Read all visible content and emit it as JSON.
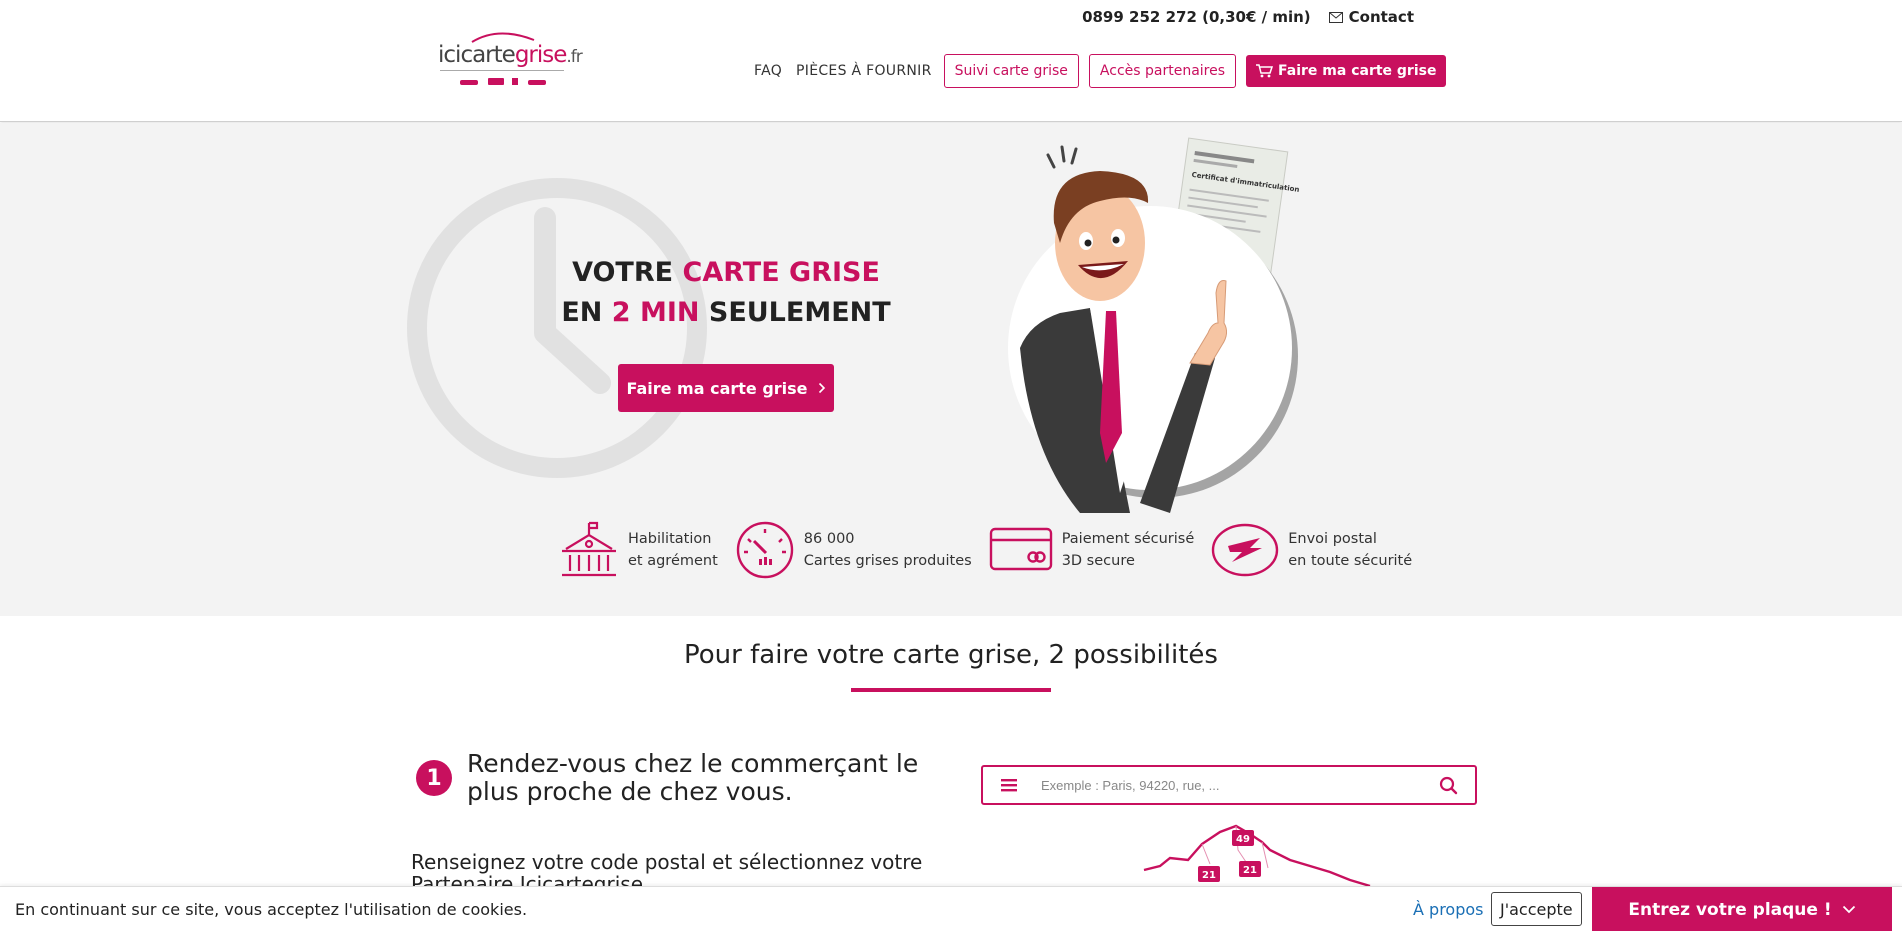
{
  "header": {
    "logo": {
      "part1": "ici",
      "part2": "carte",
      "part3": "grise",
      "part4": ".fr"
    },
    "phone": "0899 252 272 (0,30€ / min)",
    "contact": "Contact",
    "nav": {
      "faq": "FAQ",
      "pieces": "PIÈCES À FOURNIR",
      "suivi": "Suivi carte grise",
      "acces": "Accès partenaires",
      "faire": "Faire ma carte grise"
    }
  },
  "hero": {
    "line1_a": "VOTRE ",
    "line1_b": "CARTE GRISE",
    "line2_a": "EN ",
    "line2_b": "2 MIN",
    "line2_c": " SEULEMENT",
    "button": "Faire ma carte grise",
    "document_title": "Certificat d'immatriculation",
    "features": [
      {
        "l1": "Habilitation",
        "l2": "et agrément"
      },
      {
        "l1": "86 000",
        "l2": "Cartes grises produites"
      },
      {
        "l1": "Paiement sécurisé",
        "l2": "3D secure"
      },
      {
        "l1": "Envoi postal",
        "l2": "en toute sécurité"
      }
    ]
  },
  "section": {
    "title": "Pour faire votre carte grise, 2 possibilités",
    "step1": {
      "number": "1",
      "title": "Rendez-vous chez le commerçant le plus proche de chez vous.",
      "desc": "Renseignez votre code postal et sélectionnez votre Partenaire Icicartegrise"
    },
    "search_placeholder": "Exemple : Paris, 94220, rue, ...",
    "map_badges": [
      "49",
      "21",
      "21"
    ]
  },
  "cookie": {
    "text": "En continuant sur ce site, vous acceptez l'utilisation de cookies.",
    "link": "À propos",
    "accept": "J'accepte",
    "plate": "Entrez votre plaque !"
  },
  "colors": {
    "accent": "#c8105e",
    "hero_bg": "#f3f3f3"
  }
}
